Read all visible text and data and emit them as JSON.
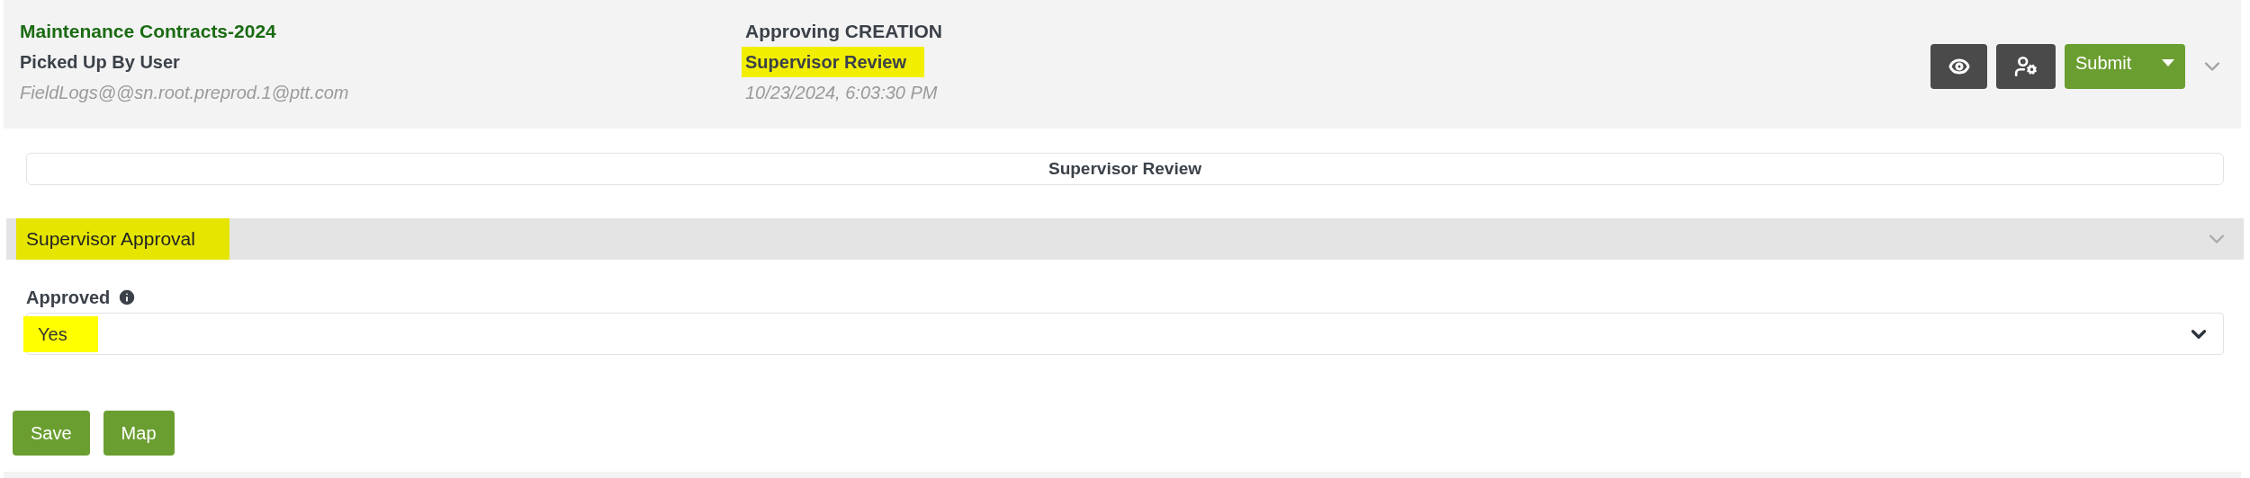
{
  "header": {
    "title": "Maintenance Contracts-2024",
    "status": "Picked Up By User",
    "user": "FieldLogs@@sn.root.preprod.1@ptt.com",
    "process": "Approving CREATION",
    "step": {
      "text": "Supervisor Review",
      "highlighted": true
    },
    "timestamp": "10/23/2024, 6:03:30 PM",
    "submit": "Submit"
  },
  "stage_title": "Supervisor Review",
  "section": {
    "title": "Supervisor Approval",
    "highlighted": true,
    "expanded": true,
    "fields": [
      {
        "label": "Approved",
        "value": "Yes",
        "highlighted": true
      }
    ]
  },
  "buttons": [
    "Save",
    "Map"
  ]
}
